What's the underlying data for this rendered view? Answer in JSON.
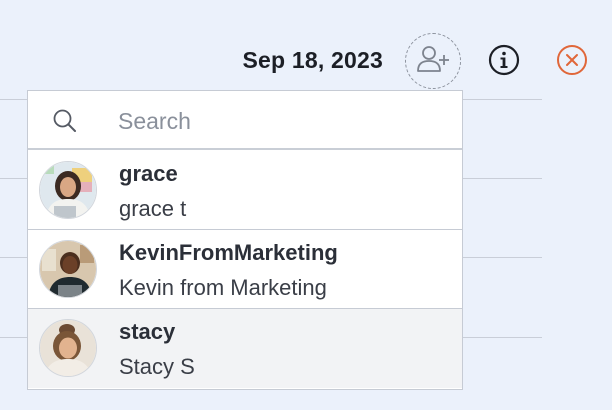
{
  "header": {
    "date": "Sep 18, 2023",
    "add_user_icon": "add-user-icon",
    "info_icon": "info-icon",
    "close_icon": "close-icon",
    "close_color": "#e0673a"
  },
  "search": {
    "placeholder": "Search",
    "value": ""
  },
  "users": [
    {
      "handle": "grace",
      "name": "grace t"
    },
    {
      "handle": "KevinFromMarketing",
      "name": "Kevin from Marketing"
    },
    {
      "handle": "stacy",
      "name": "Stacy S"
    }
  ]
}
